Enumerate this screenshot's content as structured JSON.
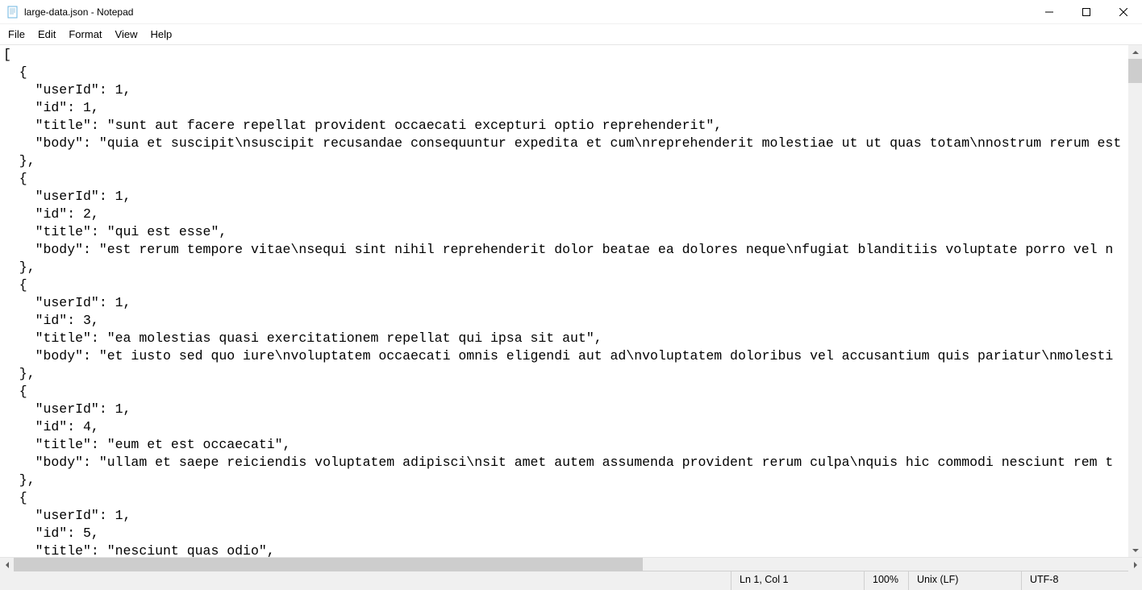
{
  "window": {
    "title": "large-data.json - Notepad"
  },
  "menu": {
    "items": [
      "File",
      "Edit",
      "Format",
      "View",
      "Help"
    ]
  },
  "editor": {
    "content": "[\n  {\n    \"userId\": 1,\n    \"id\": 1,\n    \"title\": \"sunt aut facere repellat provident occaecati excepturi optio reprehenderit\",\n    \"body\": \"quia et suscipit\\nsuscipit recusandae consequuntur expedita et cum\\nreprehenderit molestiae ut ut quas totam\\nnostrum rerum est\n  },\n  {\n    \"userId\": 1,\n    \"id\": 2,\n    \"title\": \"qui est esse\",\n    \"body\": \"est rerum tempore vitae\\nsequi sint nihil reprehenderit dolor beatae ea dolores neque\\nfugiat blanditiis voluptate porro vel n\n  },\n  {\n    \"userId\": 1,\n    \"id\": 3,\n    \"title\": \"ea molestias quasi exercitationem repellat qui ipsa sit aut\",\n    \"body\": \"et iusto sed quo iure\\nvoluptatem occaecati omnis eligendi aut ad\\nvoluptatem doloribus vel accusantium quis pariatur\\nmolesti\n  },\n  {\n    \"userId\": 1,\n    \"id\": 4,\n    \"title\": \"eum et est occaecati\",\n    \"body\": \"ullam et saepe reiciendis voluptatem adipisci\\nsit amet autem assumenda provident rerum culpa\\nquis hic commodi nesciunt rem t\n  },\n  {\n    \"userId\": 1,\n    \"id\": 5,\n    \"title\": \"nesciunt quas odio\","
  },
  "statusbar": {
    "position": "Ln 1, Col 1",
    "zoom": "100%",
    "lineending": "Unix (LF)",
    "encoding": "UTF-8"
  }
}
